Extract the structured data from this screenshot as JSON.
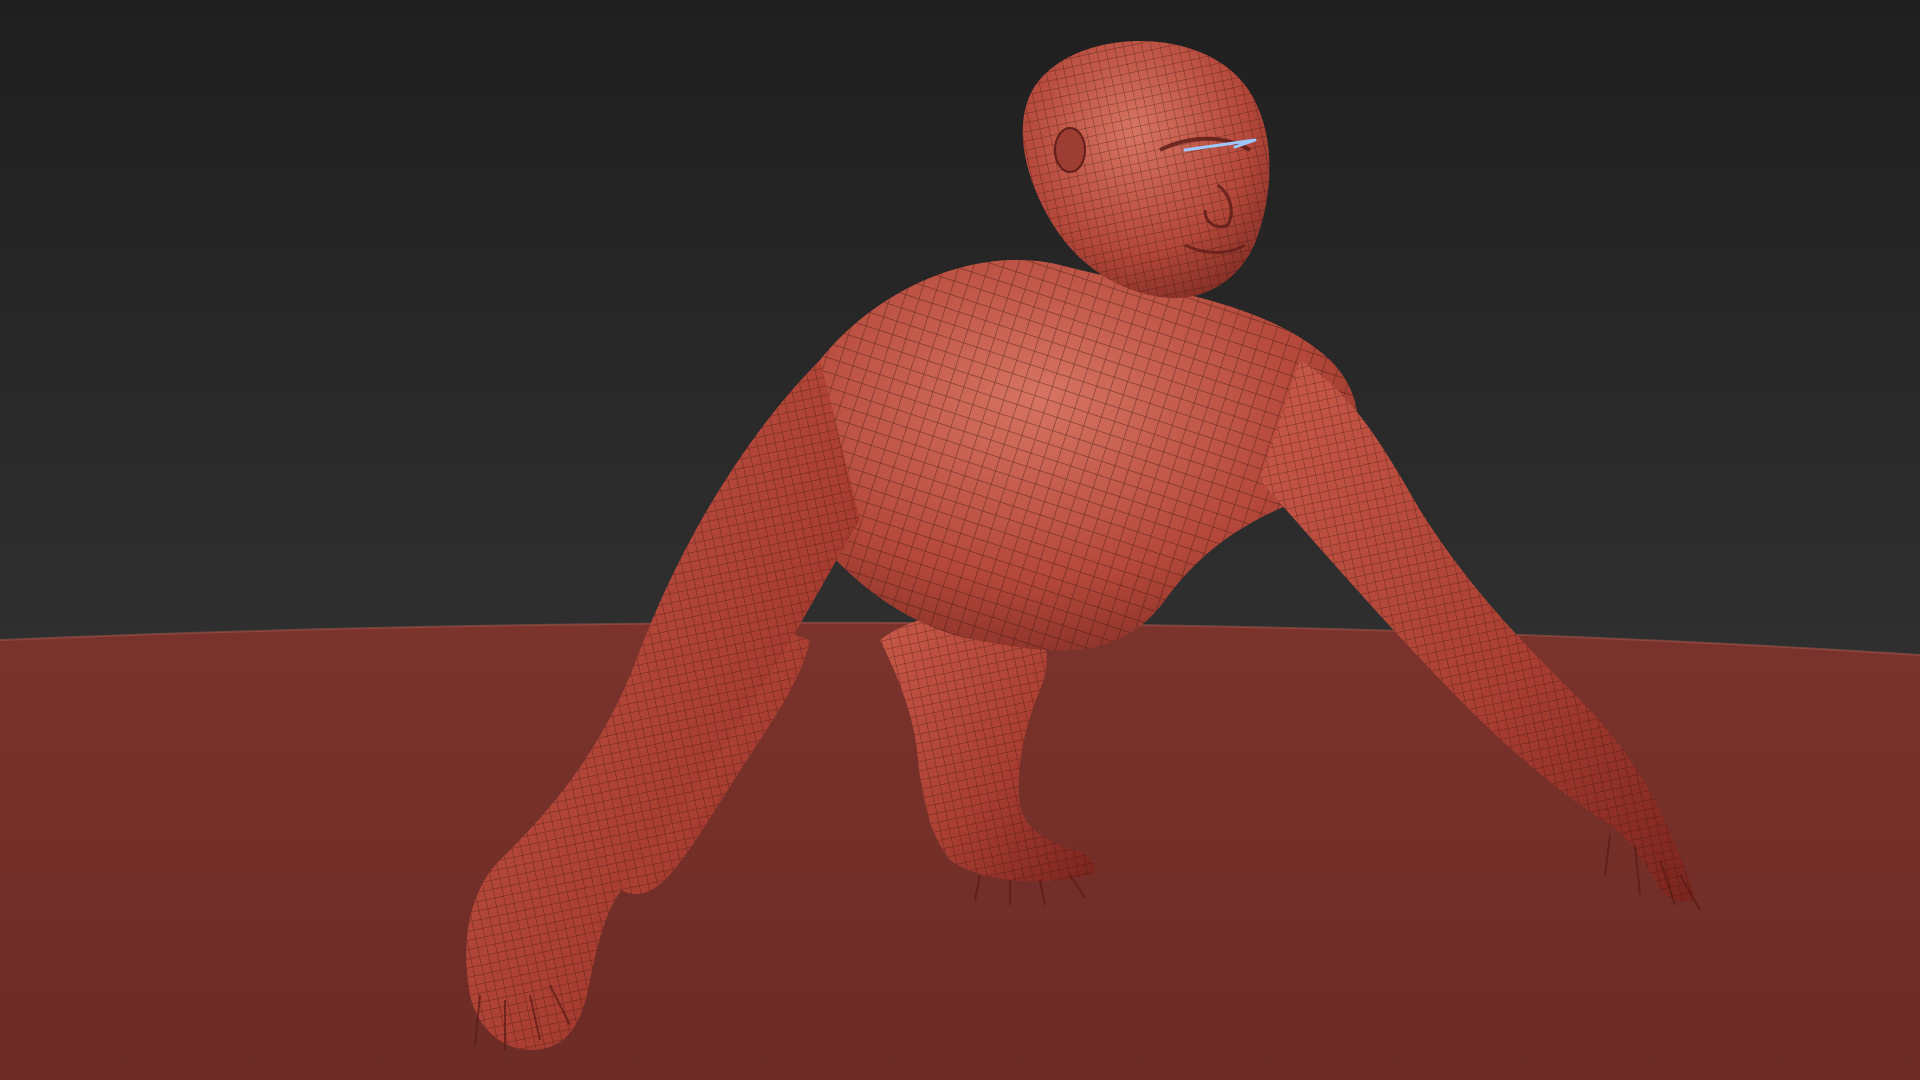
{
  "viewport": {
    "mode": "3d-render",
    "subject": "gorilla-wireframe-sculpt",
    "shading": "clay-with-wireframe"
  },
  "colors": {
    "background_top": "#1f1f1f",
    "background_bottom": "#3a3a3a",
    "ground": "#74302a",
    "ground_edge": "#a95a4e",
    "model_base": "#b4483a",
    "model_highlight": "#d77462",
    "model_shadow": "#6a211b",
    "wire": "#2a0d0a",
    "gizmo_line": "#9ec7ff"
  },
  "icons": [
    "gizmo-line-icon"
  ]
}
